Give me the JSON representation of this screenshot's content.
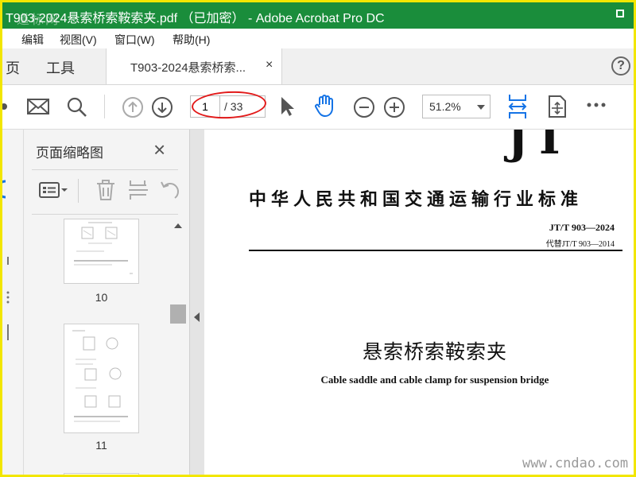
{
  "window": {
    "title": "T903-2024悬索桥索鞍索夹.pdf （已加密） - Adobe Acrobat Pro DC",
    "watermark": "道标网"
  },
  "menu": {
    "items": [
      "编辑",
      "视图(V)",
      "窗口(W)",
      "帮助(H)"
    ]
  },
  "nav": {
    "home": "页",
    "tools": "工具"
  },
  "tab": {
    "label": "T903-2024悬索桥索...",
    "close": "×"
  },
  "help": "?",
  "toolbar": {
    "page_current": "1",
    "page_total": "/ 33",
    "zoom": "51.2%"
  },
  "panel": {
    "title": "页面缩略图",
    "close": "×",
    "thumbnails": [
      {
        "label": "10"
      },
      {
        "label": "11"
      }
    ]
  },
  "document": {
    "logo": "JT",
    "ministry": "中华人民共和国交通运输行业标准",
    "code": "JT/T 903—2024",
    "replaces": "代替JT/T 903—2014",
    "title_cn": "悬索桥索鞍索夹",
    "title_en": "Cable saddle and cable clamp for suspension bridge"
  },
  "footer": {
    "site": "www.cndao.com"
  },
  "colors": {
    "titlebar": "#1a8d3b",
    "accent": "#1473e6",
    "annotation": "#e21b1b",
    "border": "#f2e600"
  }
}
